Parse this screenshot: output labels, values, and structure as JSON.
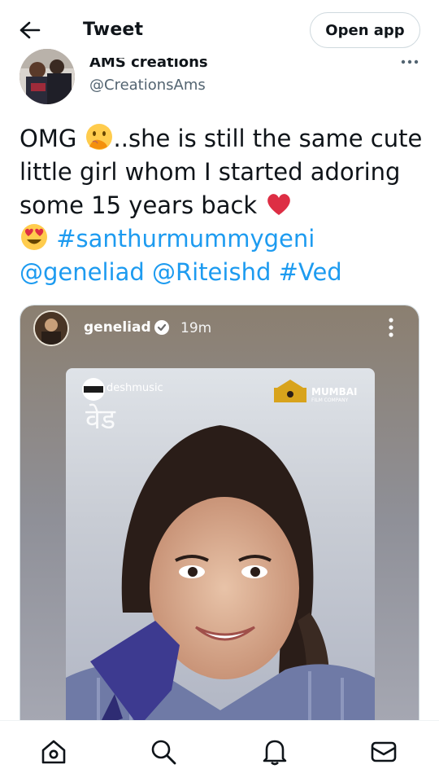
{
  "header": {
    "title": "Tweet",
    "open_app_label": "Open app"
  },
  "author": {
    "display_name": "AMS creations",
    "handle": "@CreationsAms"
  },
  "tweet": {
    "text_1": "OMG ",
    "text_2": "..she is still the same cute little girl whom I started adoring some 15 years back ",
    "text_3": " ",
    "hashtag_1": "#santhurmummygeni",
    "mention_1": "@geneliad",
    "mention_2": "@Riteishd",
    "hashtag_2": "#Ved",
    "emojis": [
      "hand-over-mouth-emoji",
      "red-heart-emoji",
      "heart-eyes-emoji"
    ]
  },
  "media": {
    "story_user": "geneliad",
    "story_time": "19m",
    "poster_brand": "deshmusic",
    "poster_title": "वेड",
    "poster_company": "MUMBAI",
    "poster_company_sub": "FILM COMPANY"
  },
  "nav": {
    "items": [
      "home-icon",
      "search-icon",
      "notifications-icon",
      "messages-icon"
    ]
  },
  "colors": {
    "link": "#1d9bf0",
    "text": "#0f1419",
    "secondary": "#536471",
    "border": "#cfd9de"
  }
}
